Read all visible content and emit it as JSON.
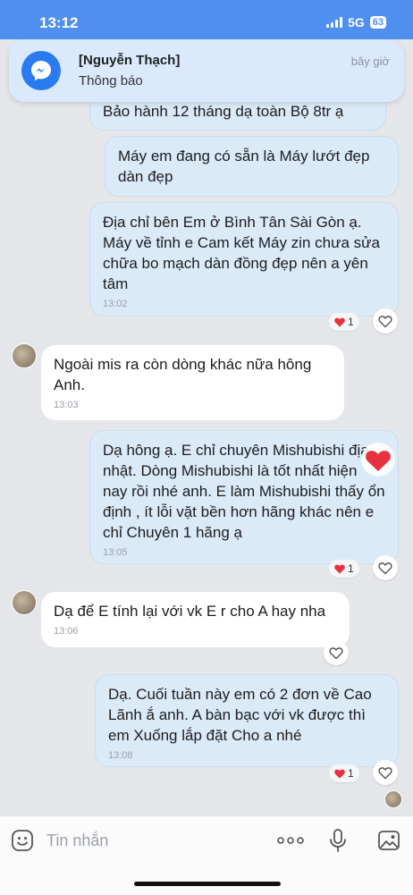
{
  "status_bar": {
    "time": "13:12",
    "network": "5G",
    "battery": "63"
  },
  "notification": {
    "sender": "[Nguyễn Thạch]",
    "body": "Thông báo",
    "time": "bây giờ"
  },
  "messages": [
    {
      "text": "Bảo hành 12 tháng dạ toàn Bộ 8tr ạ"
    },
    {
      "text": "Máy em đang có sẵn là Máy lướt đẹp dàn đẹp"
    },
    {
      "text": "Địa chỉ bên Em ở Bình Tân Sài Gòn ạ. Máy về tỉnh e Cam kết Máy zin chưa sửa chữa bo mạch dàn đồng đẹp nên a yên tâm",
      "time": "13:02",
      "reaction_count": "1"
    },
    {
      "text": "Ngoài mis ra còn dòng khác nữa hông Anh.",
      "time": "13:03"
    },
    {
      "text": "Dạ hông ạ. E chỉ chuyên Mishubishi địa nhật. Dòng Mishubishi là tốt nhất hiện nay rồi nhé anh. E làm Mishubishi thấy ổn định , ít lỗi vặt bền hơn hãng khác nên e chỉ Chuyên 1 hãng ạ",
      "time": "13:05",
      "reaction_count": "1"
    },
    {
      "text": "Dạ để E tính lại với vk E r cho A hay nha",
      "time": "13:06"
    },
    {
      "text": "Dạ. Cuối tuần này em có 2 đơn về Cao Lãnh ắ anh. A bàn bạc với vk được thì em Xuống lắp đặt Cho a nhé",
      "time": "13:08",
      "reaction_count": "1"
    }
  ],
  "composer": {
    "placeholder": "Tin nhắn"
  },
  "icons": [
    "messenger-icon",
    "emoji-icon",
    "more-icon",
    "mic-icon",
    "image-icon",
    "heart-icon",
    "like-icon"
  ],
  "colors": {
    "header": "#4f8ff0",
    "outgoing_bubble": "#dbeaf7",
    "incoming_bubble": "#ffffff",
    "background": "#e4e6ea",
    "heart": "#e8313f"
  }
}
